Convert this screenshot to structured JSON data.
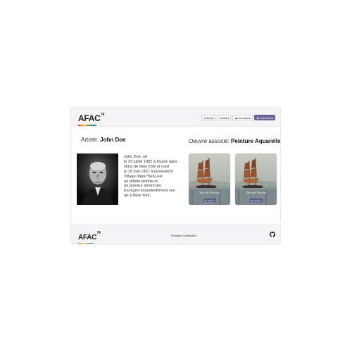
{
  "header": {
    "logo": {
      "text": "AFAC",
      "sup": "74"
    },
    "nav": [
      {
        "label": "Galeries",
        "icon": ""
      },
      {
        "label": "Artistes",
        "icon": ""
      },
      {
        "label": "Inscription",
        "icon": "user-plus-icon"
      },
      {
        "label": "Connexion",
        "icon": "user-icon"
      }
    ]
  },
  "main": {
    "artist_prefix": "Artiste: ",
    "artist_name": "John Doe",
    "work_prefix": "Oeuvre associé: ",
    "work_name": "Peinture Aquarelle",
    "bio_lines": [
      "John Doe, né",
      "le 22 juillet 1882 à Nyack dans",
      "l'État de New York et mort",
      "le 15 mai 1967 à Greenwich",
      "Village (New York),est",
      "un artiste peintre et",
      "un graveur américain.",
      "Exerçant essentiellement son",
      "art à New York,"
    ],
    "cards": [
      {
        "title": "Titre de l'Oeuvre",
        "button": "En savoir +"
      },
      {
        "title": "Titre de l'Oeuvre",
        "button": "En savoir +"
      }
    ]
  },
  "footer": {
    "logo": {
      "text": "AFAC",
      "sup": "74"
    },
    "link": "Politique d'utilisation",
    "icon": "github-icon"
  },
  "colors": {
    "accent": "#6a6494",
    "header_bg": "#f4f4f6"
  }
}
